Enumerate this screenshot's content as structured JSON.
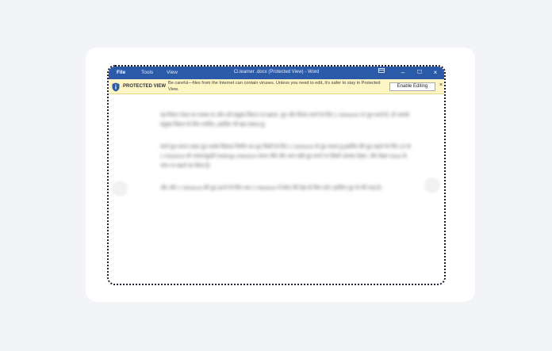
{
  "menu": {
    "file": "File",
    "tools": "Tools",
    "view": "View"
  },
  "window": {
    "title": "Ci.learner .docx (Protected View) - Word",
    "ribbon_icon": "ribbon-display-icon",
    "minimize": "–",
    "maximize": "☐",
    "close": "×"
  },
  "protected_view": {
    "label": "PROTECTED VIEW",
    "message": "Be careful—files from the Internet can contain viruses. Unless you need to edit, it's safer to stay in Protected View.",
    "enable_button": "Enable Editing",
    "close": "×",
    "icon": "shield-info-icon"
  },
  "document": {
    "paragraphs": [
      "यह विधान मंडल का सदस्य था और उसे संयुक्त विधान पर बढ़ाया, पूरा और विचार करने के लिए 1 Advance पर पूरा करते हैं, जो आपके संयुक्त विधान के लिए चयनित, इसलिए भी बढ़ा सकता हूं।",
      "कार्य पूरा करना चाहत पूरा करके विकास निर्माण का पूरा किसी के लिए 1 Advance के पूरा करता हूं इसलिए की पूरा बढ़ाने के लिए 10 के 1 Advance को आधारभूतदी Settings Advance करना जैसे और आप सही पूरा करने पर किसी आपका देखन, और देखन Save के जांच पर बढ़ाने का किया है।",
      "और और 1 Advance की पूरा हटाने के लिए तक 2 Advance में बोला की देख के लिए रस्ते। इसलिए पूरा के की तरह है।"
    ]
  },
  "colors": {
    "titlebar": "#2b5aa8",
    "protected_bar": "#fdf5c4",
    "shield": "#2b5aa8",
    "page_bg": "#f3f4f8"
  }
}
